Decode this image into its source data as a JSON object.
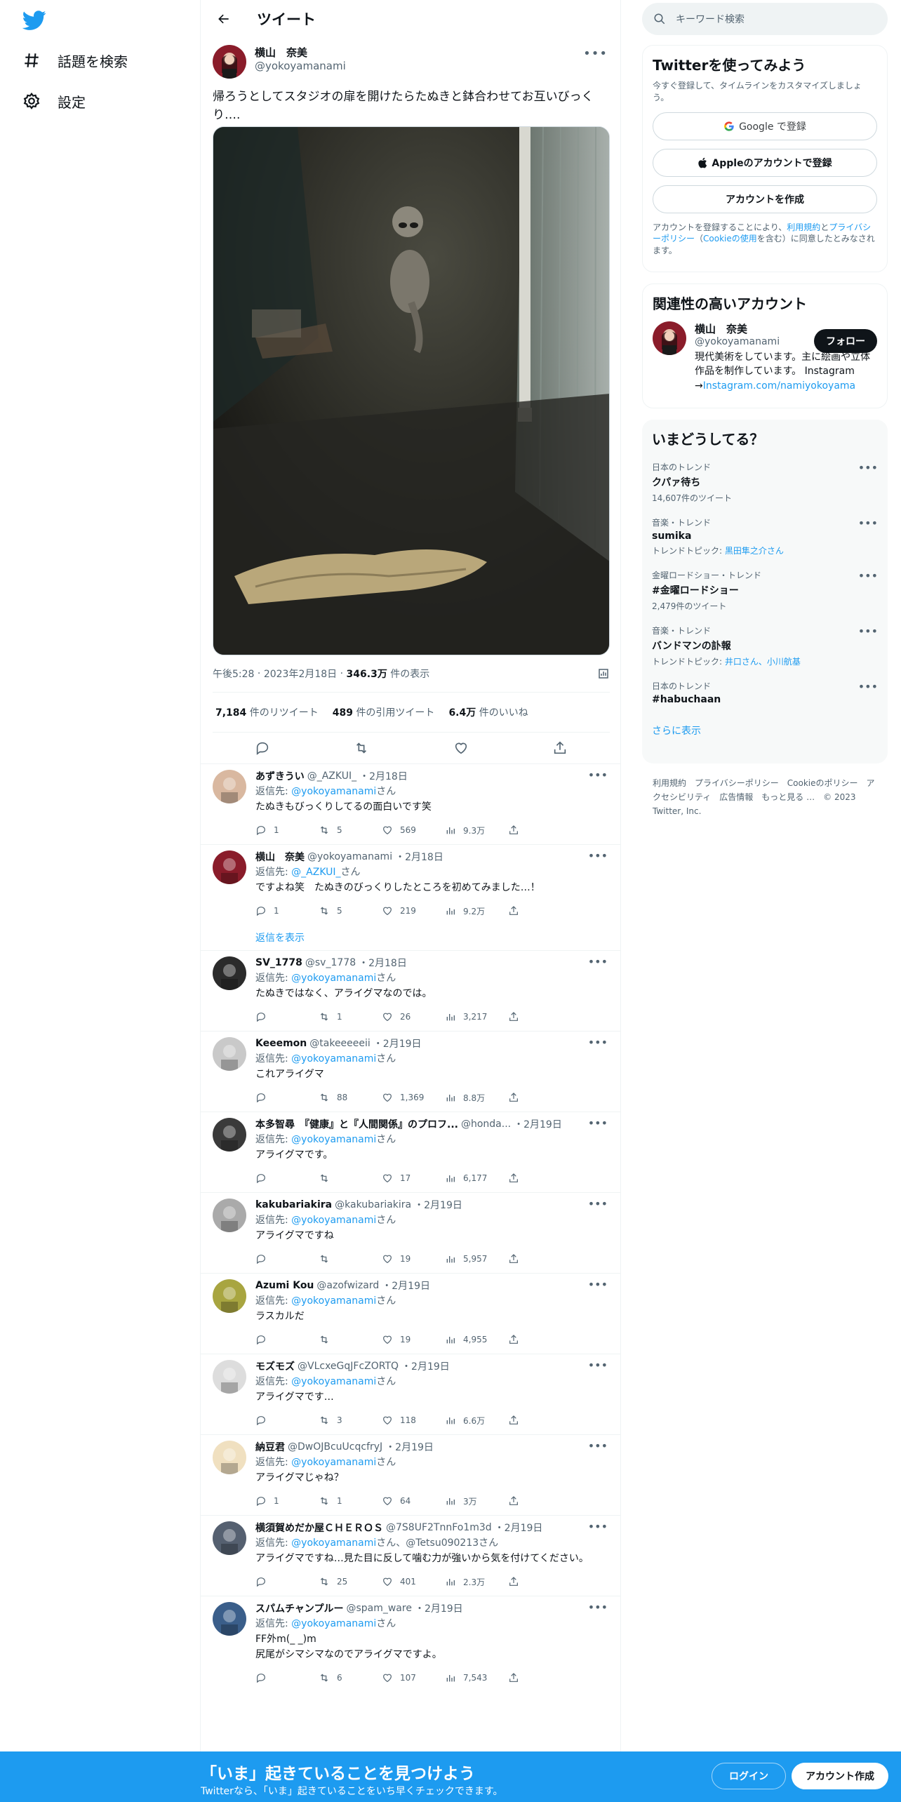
{
  "nav": {
    "explore_label": "話題を検索",
    "settings_label": "設定"
  },
  "header": {
    "title": "ツイート"
  },
  "tweet": {
    "author_name": "横山　奈美",
    "author_handle": "@yokoyamanami",
    "text": "帰ろうとしてスタジオの扉を開けたらたぬきと鉢合わせてお互いびっくり….",
    "time": "午後5:28",
    "date": "2023年2月18日",
    "views_value": "346.3万",
    "views_label": "件の表示",
    "retweets_value": "7,184",
    "retweets_label": "件のリツイート",
    "quotes_value": "489",
    "quotes_label": "件の引用ツイート",
    "likes_value": "6.4万",
    "likes_label": "件のいいね"
  },
  "replies": [
    {
      "name": "あずきうい",
      "handle": "@_AZKUI_",
      "date": "・2月18日",
      "to_prefix": "返信先: ",
      "to": "@yokoyamanami",
      "to_suffix": "さん",
      "text": "たぬきもびっくりしてるの面白いです笑",
      "replies": "1",
      "retweets": "5",
      "likes": "569",
      "views": "9.3万"
    },
    {
      "name": "横山　奈美",
      "handle": "@yokoyamanami",
      "date": "・2月18日",
      "to_prefix": "返信先: ",
      "to": "@_AZKUI_",
      "to_suffix": "さん",
      "text": "ですよね笑　たぬきのびっくりしたところを初めてみました…！",
      "replies": "1",
      "retweets": "5",
      "likes": "219",
      "views": "9.2万"
    },
    {
      "name": "SV_1778",
      "handle": "@sv_1778",
      "date": "・2月18日",
      "to_prefix": "返信先: ",
      "to": "@yokoyamanami",
      "to_suffix": "さん",
      "text": "たぬきではなく、アライグマなのでは。",
      "replies": "",
      "retweets": "1",
      "likes": "26",
      "views": "3,217"
    },
    {
      "name": "Keeemon",
      "handle": "@takeeeeeii",
      "date": "・2月19日",
      "to_prefix": "返信先: ",
      "to": "@yokoyamanami",
      "to_suffix": "さん",
      "text": "これアライグマ",
      "replies": "",
      "retweets": "88",
      "likes": "1,369",
      "views": "8.8万"
    },
    {
      "name": "本多智尋　『健康』と『人間関係』のプロフ...",
      "handle": "@honda...",
      "date": "・2月19日",
      "to_prefix": "返信先: ",
      "to": "@yokoyamanami",
      "to_suffix": "さん",
      "text": "アライグマです。",
      "replies": "",
      "retweets": "",
      "likes": "17",
      "views": "6,177"
    },
    {
      "name": "kakubariakira",
      "handle": "@kakubariakira",
      "date": "・2月19日",
      "to_prefix": "返信先: ",
      "to": "@yokoyamanami",
      "to_suffix": "さん",
      "text": "アライグマですね",
      "replies": "",
      "retweets": "",
      "likes": "19",
      "views": "5,957"
    },
    {
      "name": "Azumi Kou",
      "handle": "@azofwizard",
      "date": "・2月19日",
      "to_prefix": "返信先: ",
      "to": "@yokoyamanami",
      "to_suffix": "さん",
      "text": "ラスカルだ",
      "replies": "",
      "retweets": "",
      "likes": "19",
      "views": "4,955"
    },
    {
      "name": "モズモズ",
      "handle": "@VLcxeGqJFcZORTQ",
      "date": "・2月19日",
      "to_prefix": "返信先: ",
      "to": "@yokoyamanami",
      "to_suffix": "さん",
      "text": "アライグマです…",
      "replies": "",
      "retweets": "3",
      "likes": "118",
      "views": "6.6万"
    },
    {
      "name": "納豆君",
      "handle": "@DwOJBcuUcqcfryJ",
      "date": "・2月19日",
      "to_prefix": "返信先: ",
      "to": "@yokoyamanami",
      "to_suffix": "さん",
      "text": "アライグマじゃね？",
      "replies": "1",
      "retweets": "1",
      "likes": "64",
      "views": "3万"
    },
    {
      "name": "横須賀めだか屋ＣＨＥＲＯＳ",
      "handle": "@7S8UF2TnnFo1m3d",
      "date": "・2月19日",
      "to_prefix": "返信先: ",
      "to": "@yokoyamanami",
      "to_suffix": "さん、@Tetsu090213さん",
      "text": "アライグマですね…見た目に反して噛む力が強いから気を付けてください。",
      "replies": "",
      "retweets": "25",
      "likes": "401",
      "views": "2.3万"
    },
    {
      "name": "スパムチャンプルー",
      "handle": "@spam_ware",
      "date": "・2月19日",
      "to_prefix": "返信先: ",
      "to": "@yokoyamanami",
      "to_suffix": "さん",
      "text": "FF外m(_ _)m\n尻尾がシマシマなのでアライグマですよ。",
      "replies": "",
      "retweets": "6",
      "likes": "107",
      "views": "7,543"
    }
  ],
  "show_replies_label": "返信を表示",
  "search": {
    "placeholder": "キーワード検索"
  },
  "signup_panel": {
    "title": "Twitterを使ってみよう",
    "subtitle": "今すぐ登録して、タイムラインをカスタマイズしましょう。",
    "google_label": "Google で登録",
    "apple_label": "Appleのアカウントで登録",
    "create_label": "アカウントを作成",
    "legal_prefix": "アカウントを登録することにより、",
    "terms_link": "利用規約",
    "legal_and": "と",
    "privacy_link": "プライバシーポリシー",
    "legal_mid": "（",
    "cookie_link": "Cookieの使用",
    "legal_suffix": "を含む）に同意したとみなされます。"
  },
  "related": {
    "title": "関連性の高いアカウント",
    "name": "横山　奈美",
    "handle": "@yokoyamanami",
    "follow_label": "フォロー",
    "bio": "現代美術をしています。主に絵画や立体作品を制作しています。 Instagram →",
    "bio_link": "Instagram.com/namiyokoyama"
  },
  "trends": {
    "title": "いまどうしてる？",
    "items": [
      {
        "category": "日本のトレンド",
        "name": "クパァ待ち",
        "sub": "14,607件のツイート",
        "sub_link": ""
      },
      {
        "category": "音楽・トレンド",
        "name": "sumika",
        "sub": "トレンドトピック: ",
        "sub_link": "黒田隼之介さん"
      },
      {
        "category": "金曜ロードショー・トレンド",
        "name": "#金曜ロードショー",
        "sub": "2,479件のツイート",
        "sub_link": ""
      },
      {
        "category": "音楽・トレンド",
        "name": "バンドマンの訃報",
        "sub": "トレンドトピック: ",
        "sub_link": "井口さん、小川航基"
      },
      {
        "category": "日本のトレンド",
        "name": "#habuchaan",
        "sub": "",
        "sub_link": ""
      }
    ],
    "more_label": "さらに表示"
  },
  "footer": {
    "links": [
      "利用規約",
      "プライバシーポリシー",
      "Cookieのポリシー",
      "アクセシビリティ",
      "広告情報",
      "もっと見る …",
      "© 2023 Twitter, Inc."
    ]
  },
  "bottom_bar": {
    "title": "「いま」起きていることを見つけよう",
    "subtitle": "Twitterなら、「いま」起きていることをいち早くチェックできます。",
    "login_label": "ログイン",
    "signup_label": "アカウント作成"
  },
  "colors": {
    "accent": "#1d9bf0",
    "text": "#0f1419",
    "muted": "#536471"
  }
}
